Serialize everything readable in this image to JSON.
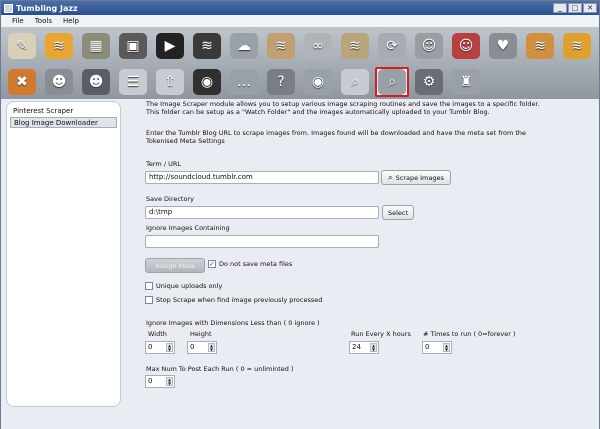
{
  "window": {
    "title": "Tumbling Jazz",
    "buttons": [
      "_",
      "□",
      "✕"
    ]
  },
  "menu": [
    {
      "label": "File"
    },
    {
      "label": "Tools"
    },
    {
      "label": "Help"
    }
  ],
  "toolbar": {
    "row1": [
      {
        "name": "edit-post-icon",
        "glyph": "✎",
        "color": "#d9d0b8"
      },
      {
        "name": "rss-text-icon",
        "glyph": "≋",
        "color": "#e8a533"
      },
      {
        "name": "map-image-icon",
        "glyph": "▦",
        "color": "#8c8c7a"
      },
      {
        "name": "photo-rss-icon",
        "glyph": "▣",
        "color": "#5a5a5a"
      },
      {
        "name": "video-clapper-icon",
        "glyph": "▶",
        "color": "#222222"
      },
      {
        "name": "video-rss-icon",
        "glyph": "≋",
        "color": "#3a3a3a"
      },
      {
        "name": "cloud-add-icon",
        "glyph": "☁",
        "color": "#9aa0a8"
      },
      {
        "name": "cloud-rss-icon",
        "glyph": "≋",
        "color": "#c0a070"
      },
      {
        "name": "link-icon",
        "glyph": "∞",
        "color": "#b0b4b8"
      },
      {
        "name": "link-rss-icon",
        "glyph": "≋",
        "color": "#b9a57a"
      },
      {
        "name": "recycle-icon",
        "glyph": "⟳",
        "color": "#a8acb2"
      },
      {
        "name": "user-add-icon",
        "glyph": "☺",
        "color": "#9a9ea4"
      },
      {
        "name": "user-remove-icon",
        "glyph": "☺",
        "color": "#b84040"
      },
      {
        "name": "heart-icon",
        "glyph": "♥",
        "color": "#8a8e94"
      },
      {
        "name": "heart-rss-icon",
        "glyph": "≋",
        "color": "#d09040"
      },
      {
        "name": "group-rss-icon",
        "glyph": "≋",
        "color": "#e0a030"
      }
    ],
    "row2": [
      {
        "name": "delete-icon",
        "glyph": "✖",
        "color": "#d07a30"
      },
      {
        "name": "users-add-icon",
        "glyph": "☻",
        "color": "#8a8e94"
      },
      {
        "name": "user-badge-icon",
        "glyph": "☻",
        "color": "#5a5e64"
      },
      {
        "name": "list-icon",
        "glyph": "☰",
        "color": "#c8ccd2"
      },
      {
        "name": "upload-icon",
        "glyph": "⇧",
        "color": "#c8ccd2"
      },
      {
        "name": "wireless-icon",
        "glyph": "◉",
        "color": "#303030"
      },
      {
        "name": "chat-icon",
        "glyph": "…",
        "color": "#9aa0a8"
      },
      {
        "name": "help-chat-icon",
        "glyph": "?",
        "color": "#7a7e84"
      },
      {
        "name": "eye-image-icon",
        "glyph": "◉",
        "color": "#9aa0a8"
      },
      {
        "name": "magnifier-icon",
        "glyph": "⌕",
        "color": "#c8ccd2"
      },
      {
        "name": "image-scraper-icon",
        "glyph": "⌕",
        "color": "#9aa0a8"
      },
      {
        "name": "settings-gear-icon",
        "glyph": "⚙",
        "color": "#6a6e74"
      },
      {
        "name": "robot-icon",
        "glyph": "♜",
        "color": "#9aa0a8"
      }
    ]
  },
  "sidebar": {
    "items": [
      {
        "label": "Pinterest Scraper"
      },
      {
        "label": "Blog Image Downloader"
      }
    ]
  },
  "main": {
    "description": "The Image Scraper module allows you to setup various image scraping routines and save the images to a specific folder. This folder can be setup as a \"Watch Folder\" and the images automatically uploaded to your Tumblr Blog.",
    "instruction": "Enter the Tumblr Blog URL to scrape images from. Images found will be downloaded and have the meta set from the Tokenised Meta Settings",
    "term_label": "Term / URL",
    "term_value": "http://soundcloud.tumblr.com",
    "scrape_button": "Scrape Images",
    "save_dir_label": "Save Directory",
    "save_dir_value": "d:\\tmp",
    "select_button": "Select",
    "ignore_label": "Ignore Images Containing",
    "ignore_value": "",
    "assign_meta_button": "Assign Meta",
    "no_meta_label": "Do not save meta files",
    "no_meta_checked": "✓",
    "unique_label": "Unique uploads only",
    "stop_label": "Stop Scrape when find image previously processed",
    "dims_label": "Ignore Images with Dimensions Less than ( 0 ignore )",
    "width_label": "Width",
    "width_value": "0",
    "height_label": "Height",
    "height_value": "0",
    "run_label": "Run Every X hours",
    "run_value": "24",
    "times_label": "# Times to run ( 0=forever )",
    "times_value": "0",
    "max_label": "Max Num To Post Each Run ( 0 = unliminted )",
    "max_value": "0"
  }
}
